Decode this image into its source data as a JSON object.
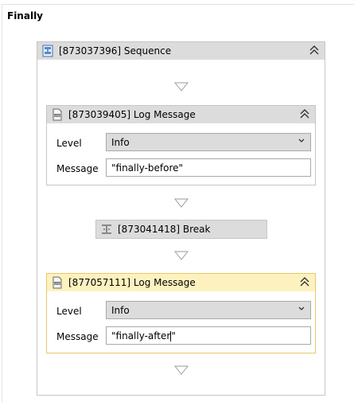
{
  "finally": {
    "title": "Finally"
  },
  "sequence": {
    "title": "[873037396] Sequence"
  },
  "log1": {
    "title": "[873039405] Log Message",
    "level_label": "Level",
    "level_value": "Info",
    "message_label": "Message",
    "message_value": "\"finally-before\""
  },
  "break": {
    "title": "[873041418] Break"
  },
  "log2": {
    "title": "[877057111] Log Message",
    "level_label": "Level",
    "level_value": "Info",
    "message_label": "Message",
    "message_value_before_caret": "\"finally-after",
    "message_value_after_caret": "\""
  },
  "colors": {
    "header_gray": "#dcdcdc",
    "selected_header": "#fdf2bf",
    "selected_border": "#e8c86a",
    "border": "#c6c6c6"
  }
}
